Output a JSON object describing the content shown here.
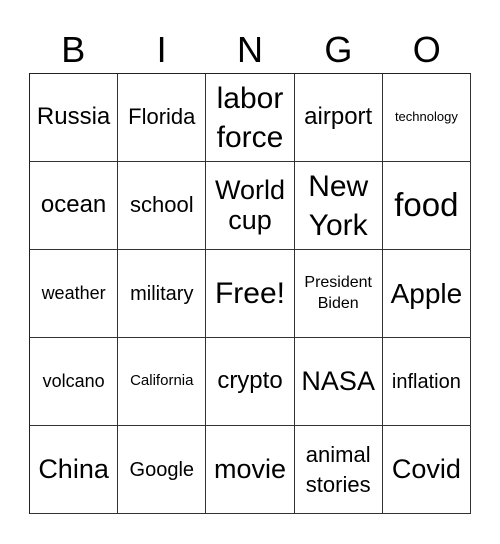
{
  "header": [
    "B",
    "I",
    "N",
    "G",
    "O"
  ],
  "cells": [
    "Russia",
    "Florida",
    "labor force",
    "airport",
    "technology",
    "ocean",
    "school",
    "World cup",
    "New York",
    "food",
    "weather",
    "military",
    "Free!",
    "President Biden",
    "Apple",
    "volcano",
    "California",
    "crypto",
    "NASA",
    "inflation",
    "China",
    "Google",
    "movie",
    "animal stories",
    "Covid"
  ]
}
